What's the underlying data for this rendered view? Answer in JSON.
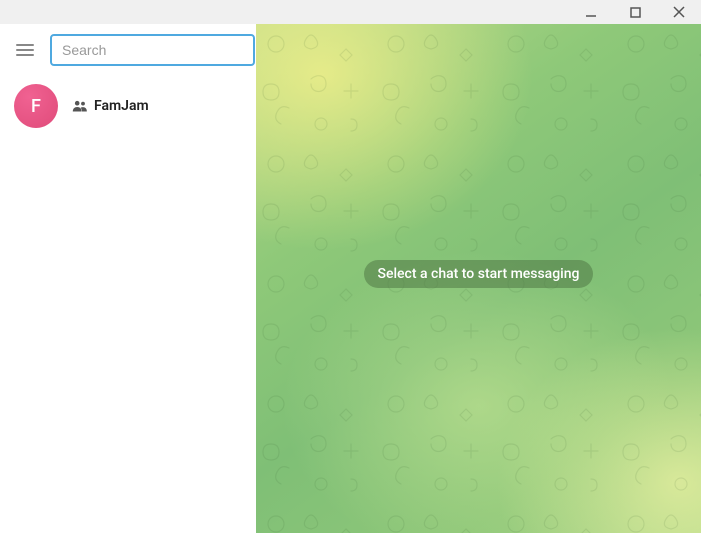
{
  "window": {
    "minimize": "–",
    "maximize": "□",
    "close": "×"
  },
  "sidebar": {
    "search": {
      "placeholder": "Search",
      "value": ""
    },
    "chats": [
      {
        "avatar_letter": "F",
        "name": "FamJam",
        "is_group": true
      }
    ]
  },
  "main": {
    "prompt": "Select a chat to start messaging"
  }
}
